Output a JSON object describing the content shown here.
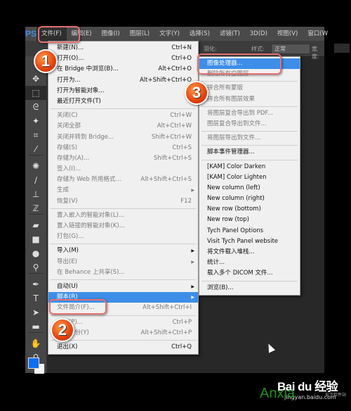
{
  "app": {
    "logo": "PS",
    "menubar": [
      "文件(F)",
      "编辑(E)",
      "图像(I)",
      "图层(L)",
      "文字(Y)",
      "选择(S)",
      "滤镜(T)",
      "3D(D)",
      "视图(V)",
      "窗口(W"
    ],
    "active_menu": "文件(F)",
    "options_bar": {
      "feather_label": "羽化:",
      "style_label": "样式:",
      "style_value": "正常",
      "width_label": "宽度:"
    }
  },
  "toolbar": {
    "tools": [
      {
        "icon": "move-icon",
        "glyph": "✥"
      },
      {
        "icon": "marquee-icon",
        "glyph": "⬚"
      },
      {
        "icon": "lasso-icon",
        "glyph": "ᘓ"
      },
      {
        "icon": "magic-wand-icon",
        "glyph": "✦"
      },
      {
        "icon": "crop-icon",
        "glyph": "⌗"
      },
      {
        "icon": "eyedropper-icon",
        "glyph": "⁄"
      },
      {
        "icon": "healing-brush-icon",
        "glyph": "✺"
      },
      {
        "icon": "brush-icon",
        "glyph": "∕"
      },
      {
        "icon": "stamp-icon",
        "glyph": "⊥"
      },
      {
        "icon": "history-brush-icon",
        "glyph": "ℤ"
      },
      {
        "icon": "eraser-icon",
        "glyph": "▰"
      },
      {
        "icon": "gradient-icon",
        "glyph": "■"
      },
      {
        "icon": "blur-icon",
        "glyph": "●"
      },
      {
        "icon": "dodge-icon",
        "glyph": "⚲"
      },
      {
        "icon": "pen-icon",
        "glyph": "✒"
      },
      {
        "icon": "type-icon",
        "glyph": "T"
      },
      {
        "icon": "path-selection-icon",
        "glyph": "➤"
      },
      {
        "icon": "shape-icon",
        "glyph": "▬"
      },
      {
        "icon": "hand-icon",
        "glyph": "✋"
      },
      {
        "icon": "zoom-icon",
        "glyph": "⚲"
      }
    ],
    "foreground_color": "#0f6ef0",
    "background_color": "#f5f5f5"
  },
  "file_menu": {
    "items": [
      {
        "label": "新建(N)...",
        "shortcut": "Ctrl+N"
      },
      {
        "label": "打开(O)...",
        "shortcut": "Ctrl+O"
      },
      {
        "label": "在 Bridge 中浏览(B)...",
        "shortcut": "Alt+Ctrl+O"
      },
      {
        "label": "打开为...",
        "shortcut": "Alt+Shift+Ctrl+O"
      },
      {
        "label": "打开为智能对象..."
      },
      {
        "label": "最近打开文件(T)"
      },
      {
        "sep": true
      },
      {
        "label": "关闭(C)",
        "shortcut": "Ctrl+W",
        "disabled": true
      },
      {
        "label": "关闭全部",
        "shortcut": "Alt+Ctrl+W",
        "disabled": true
      },
      {
        "label": "关闭并转到 Bridge...",
        "shortcut": "Shift+Ctrl+W",
        "disabled": true
      },
      {
        "label": "存储(S)",
        "shortcut": "Ctrl+S",
        "disabled": true
      },
      {
        "label": "存储为(A)...",
        "shortcut": "Shift+Ctrl+S",
        "disabled": true
      },
      {
        "label": "签入(I)...",
        "disabled": true
      },
      {
        "label": "存储为 Web 所用格式...",
        "shortcut": "Alt+Shift+Ctrl+S",
        "disabled": true
      },
      {
        "label": "生成",
        "submenu": true,
        "disabled": true
      },
      {
        "label": "恢复(V)",
        "shortcut": "F12",
        "disabled": true
      },
      {
        "sep": true
      },
      {
        "label": "置入嵌入的智能对象(L)...",
        "disabled": true
      },
      {
        "label": "置入链接的智能对象(K)...",
        "disabled": true
      },
      {
        "label": "打包(G)...",
        "disabled": true
      },
      {
        "sep": true
      },
      {
        "label": "导入(M)",
        "submenu": true
      },
      {
        "label": "导出(E)",
        "submenu": true,
        "disabled": true
      },
      {
        "label": "在 Behance 上共享(S)...",
        "disabled": true
      },
      {
        "sep": true
      },
      {
        "label": "自动(U)",
        "submenu": true
      },
      {
        "label": "脚本(R)",
        "submenu": true,
        "highlighted": true
      },
      {
        "label": "文件简介(F)...",
        "shortcut": "Alt+Shift+Ctrl+I",
        "disabled": true
      },
      {
        "sep": true
      },
      {
        "label": "打印(P)...",
        "shortcut": "Ctrl+P",
        "disabled": true
      },
      {
        "label": "打印一份(Y)",
        "shortcut": "Alt+Shift+Ctrl+P",
        "disabled": true
      },
      {
        "sep": true
      },
      {
        "label": "退出(X)",
        "shortcut": "Ctrl+Q"
      }
    ]
  },
  "scripts_submenu": {
    "items": [
      {
        "label": "图像处理器...",
        "highlighted": true
      },
      {
        "label": "删除所有空图层",
        "disabled": true
      },
      {
        "sep": true
      },
      {
        "label": "拼合所有蒙版",
        "disabled": true
      },
      {
        "label": "拼合所有图层效果",
        "disabled": true
      },
      {
        "sep": true
      },
      {
        "label": "将图层复合导出到 PDF...",
        "disabled": true
      },
      {
        "label": "图层复合导出到文件...",
        "disabled": true
      },
      {
        "sep": true
      },
      {
        "label": "将图层导出到文件...",
        "disabled": true
      },
      {
        "sep": true
      },
      {
        "label": "脚本事件管理器..."
      },
      {
        "sep": true
      },
      {
        "label": "[KAM] Color Darken"
      },
      {
        "label": "[KAM] Color Lighten"
      },
      {
        "label": "New column (left)"
      },
      {
        "label": "New column (right)"
      },
      {
        "label": "New row (bottom)"
      },
      {
        "label": "New row (top)"
      },
      {
        "label": "Tych Panel Options"
      },
      {
        "label": "Visit Tych Panel website"
      },
      {
        "label": "将文件载入堆栈..."
      },
      {
        "label": "统计..."
      },
      {
        "label": "载入多个 DICOM 文件..."
      },
      {
        "sep": true
      },
      {
        "label": "浏览(B)..."
      }
    ]
  },
  "annotations": {
    "step1": "1",
    "step2": "2",
    "step3": "3",
    "callout_color": "#e87070"
  },
  "watermark": {
    "brand": "Bai du 经验",
    "site": "jingyan.baidu.com",
    "overlay": "Anxia",
    "overlay_sub": "安下软件站",
    "overlay_domain": ".com"
  }
}
